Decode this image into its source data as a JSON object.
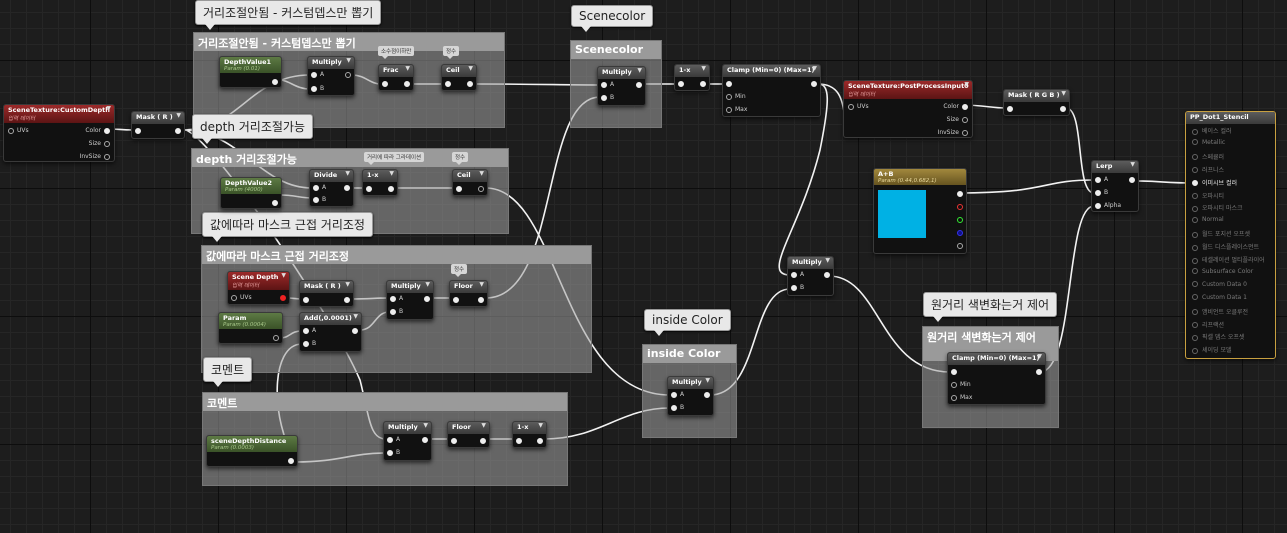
{
  "comments": [
    {
      "id": "c1",
      "title": "거리조절안됨 - 커스텀뎁스만 뽑기",
      "bubble": "거리조절안됨 - 커스텀뎁스만 뽑기"
    },
    {
      "id": "c2",
      "title": "Scenecolor",
      "bubble": "Scenecolor"
    },
    {
      "id": "c3",
      "title": "depth 거리조절가능",
      "bubble": "depth 거리조절가능"
    },
    {
      "id": "c4",
      "title": "값에따라 마스크 근접 거리조정",
      "bubble": "값에따라 마스크 근접 거리조정"
    },
    {
      "id": "c5",
      "title": "코멘트",
      "bubble": "코멘트"
    },
    {
      "id": "c6",
      "title": "inside Color",
      "bubble": "inside Color"
    },
    {
      "id": "c7",
      "title": "원거리 색변화는거 제어",
      "bubble": "원거리 색변화는거 제어"
    }
  ],
  "nodes": {
    "customdepth": {
      "title": "SceneTexture:CustomDepth",
      "sub": "입력 데이터",
      "in": [
        "UVs"
      ],
      "out": [
        "Color",
        "Size",
        "InvSize"
      ]
    },
    "mask1": {
      "title": "Mask ( R )"
    },
    "depthvalue1": {
      "title": "DepthValue1",
      "sub": "Param (0.01)"
    },
    "multiply1": {
      "title": "Multiply",
      "in": [
        "A",
        "B"
      ]
    },
    "frac": {
      "title": "Frac"
    },
    "ceil1": {
      "title": "Ceil"
    },
    "depthvalue2": {
      "title": "DepthValue2",
      "sub": "Param (4000)"
    },
    "divide": {
      "title": "Divide",
      "in": [
        "A",
        "B"
      ]
    },
    "oneminus1": {
      "title": "1-x"
    },
    "ceil2": {
      "title": "Ceil"
    },
    "scenedepth": {
      "title": "Scene Depth",
      "sub": "입력 데이터",
      "in": [
        "UVs"
      ]
    },
    "mask2": {
      "title": "Mask ( R )"
    },
    "multiply2": {
      "title": "Multiply",
      "in": [
        "A",
        "B"
      ]
    },
    "floor1": {
      "title": "Floor"
    },
    "param": {
      "title": "Param",
      "sub": "Param (0.0004)"
    },
    "add": {
      "title": "Add(,0.0001)",
      "in": [
        "A",
        "B"
      ]
    },
    "scenedepthdistance": {
      "title": "sceneDepthDistance",
      "sub": "Param (0.0003)"
    },
    "multiply3": {
      "title": "Multiply",
      "in": [
        "A",
        "B"
      ]
    },
    "floor2": {
      "title": "Floor"
    },
    "oneminus2": {
      "title": "1-x"
    },
    "multiply_sc": {
      "title": "Multiply",
      "in": [
        "A",
        "B"
      ]
    },
    "oneminus3": {
      "title": "1-x"
    },
    "clamp1": {
      "title": "Clamp (Min=0) (Max=1)",
      "in": [
        "",
        "Min",
        "Max"
      ]
    },
    "ppinput": {
      "title": "SceneTexture:PostProcessInput0",
      "sub": "입력 데이터",
      "in": [
        "UVs"
      ],
      "out": [
        "Color",
        "Size",
        "InvSize"
      ]
    },
    "maskrgb": {
      "title": "Mask ( R G B )"
    },
    "lerp": {
      "title": "Lerp",
      "in": [
        "A",
        "B",
        "Alpha"
      ]
    },
    "vector": {
      "title": "A+B",
      "sub": "Param (0.44,0.682,1)",
      "color": "#00b1e4"
    },
    "multiply4": {
      "title": "Multiply",
      "in": [
        "A",
        "B"
      ]
    },
    "multiply5": {
      "title": "Multiply",
      "in": [
        "A",
        "B"
      ]
    },
    "clamp2": {
      "title": "Clamp (Min=0) (Max=1)",
      "in": [
        "",
        "Min",
        "Max"
      ]
    }
  },
  "tags": {
    "t1": "소수점이하만",
    "t2": "정수",
    "t3": "거리에 따라 그라데이션",
    "t4": "정수",
    "t5": "정수"
  },
  "output": {
    "title": "PP_Dot1_Stencil",
    "rows": [
      "베이스 컬러",
      "Metallic",
      "스페큘러",
      "러프니스",
      "이미시브 컬러",
      "오파시티",
      "오파시티 마스크",
      "Normal",
      "월드 포지션 오프셋",
      "월드 디스플레이스먼트",
      "테셀레이션 멀티플라이어",
      "Subsurface Color",
      "Custom Data 0",
      "Custom Data 1",
      "앰비언트 오클루전",
      "리프랙션",
      "픽셀 뎁스 오프셋",
      "셰이딩 모델"
    ],
    "active_index": 4
  }
}
